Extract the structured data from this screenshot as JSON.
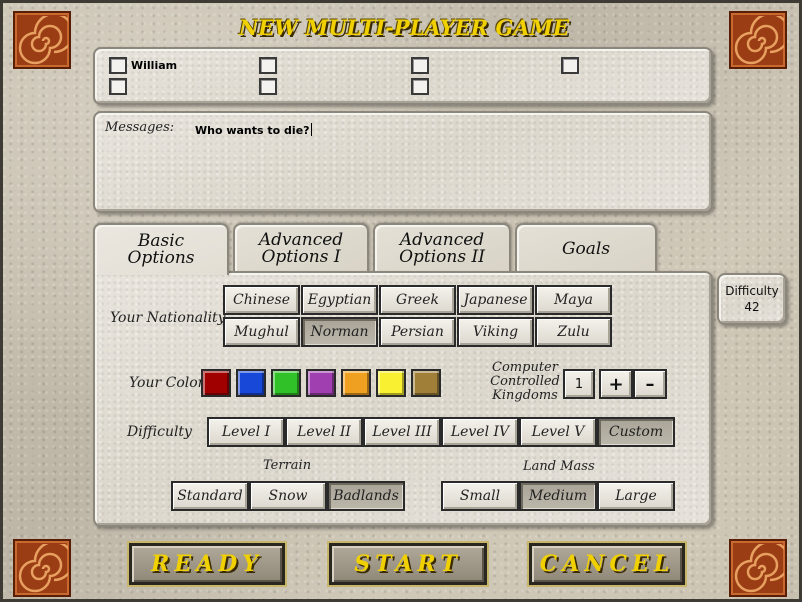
{
  "title": "NEW MULTI-PLAYER GAME",
  "players": [
    {
      "name": "William"
    },
    {
      "name": ""
    },
    {
      "name": ""
    },
    {
      "name": ""
    },
    {
      "name": ""
    },
    {
      "name": ""
    },
    {
      "name": ""
    }
  ],
  "messages": {
    "label": "Messages:",
    "text": "Who wants to die?"
  },
  "tabs": [
    {
      "line1": "Basic",
      "line2": "Options",
      "active": true
    },
    {
      "line1": "Advanced",
      "line2": "Options I",
      "active": false
    },
    {
      "line1": "Advanced",
      "line2": "Options II",
      "active": false
    },
    {
      "line1": "Goals",
      "line2": "",
      "active": false
    }
  ],
  "difficulty_badge": {
    "label": "Difficulty",
    "value": "42"
  },
  "nationality": {
    "label": "Your Nationality",
    "options": [
      "Chinese",
      "Egyptian",
      "Greek",
      "Japanese",
      "Maya",
      "Mughul",
      "Norman",
      "Persian",
      "Viking",
      "Zulu"
    ],
    "selected": "Norman"
  },
  "color": {
    "label": "Your Color",
    "swatches": [
      "#a00000",
      "#1848d8",
      "#30c028",
      "#a040b0",
      "#f0a020",
      "#f8f030",
      "#a08038"
    ]
  },
  "computer_kingdoms": {
    "label_lines": [
      "Computer",
      "Controlled",
      "Kingdoms"
    ],
    "value": "1",
    "plus": "+",
    "minus": "–"
  },
  "difficulty": {
    "label": "Difficulty",
    "options": [
      "Level I",
      "Level II",
      "Level III",
      "Level IV",
      "Level V",
      "Custom"
    ],
    "selected": "Custom"
  },
  "terrain": {
    "label": "Terrain",
    "options": [
      "Standard",
      "Snow",
      "Badlands"
    ],
    "selected": "Badlands"
  },
  "land_mass": {
    "label": "Land Mass",
    "options": [
      "Small",
      "Medium",
      "Large"
    ],
    "selected": "Medium"
  },
  "actions": {
    "ready": "READY",
    "start": "START",
    "cancel": "CANCEL"
  }
}
